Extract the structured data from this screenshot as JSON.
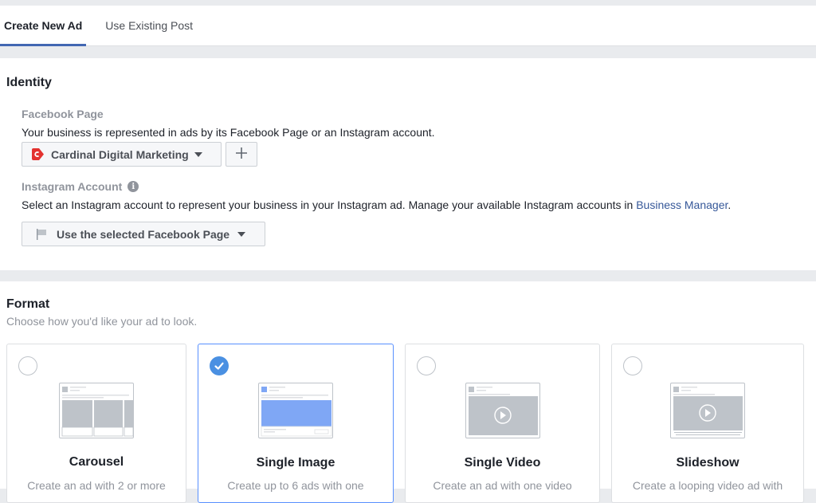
{
  "tabs": [
    {
      "label": "Create New Ad",
      "active": true
    },
    {
      "label": "Use Existing Post",
      "active": false
    }
  ],
  "identity": {
    "title": "Identity",
    "facebook_page": {
      "label": "Facebook Page",
      "description": "Your business is represented in ads by its Facebook Page or an Instagram account.",
      "selected_page": "Cardinal Digital Marketing",
      "page_icon": "cardinal-logo-icon",
      "add_button_icon": "plus-icon"
    },
    "instagram_account": {
      "label": "Instagram Account",
      "info_icon": "info-icon",
      "description_prefix": "Select an Instagram account to represent your business in your Instagram ad. Manage your available Instagram accounts in ",
      "link_text": "Business Manager",
      "description_suffix": ".",
      "selected_account": "Use the selected Facebook Page",
      "account_icon": "flag-icon"
    }
  },
  "format": {
    "title": "Format",
    "subtitle": "Choose how you'd like your ad to look.",
    "options": [
      {
        "name": "Carousel",
        "description": "Create an ad with 2 or more",
        "selected": false,
        "thumbnail": "carousel-preview"
      },
      {
        "name": "Single Image",
        "description": "Create up to 6 ads with one",
        "selected": true,
        "thumbnail": "single-image-preview"
      },
      {
        "name": "Single Video",
        "description": "Create an ad with one video",
        "selected": false,
        "thumbnail": "single-video-preview"
      },
      {
        "name": "Slideshow",
        "description": "Create a looping video ad with",
        "selected": false,
        "thumbnail": "slideshow-preview"
      }
    ]
  },
  "colors": {
    "accent": "#4267b2",
    "link": "#365899",
    "selected_border": "#5890ff",
    "check": "#4a90e2",
    "brand_red": "#e3322f"
  }
}
